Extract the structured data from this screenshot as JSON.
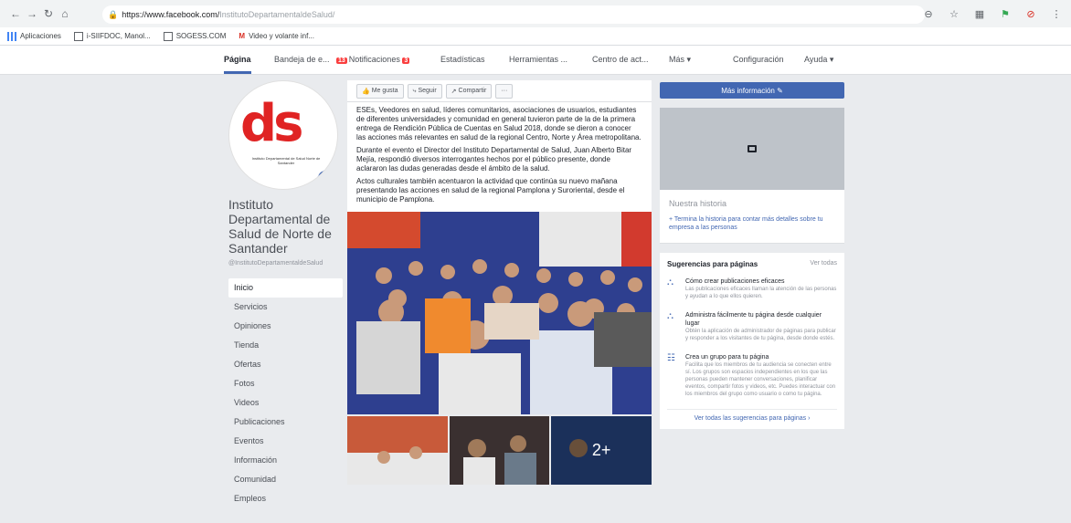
{
  "browser": {
    "url_host": "https://www.facebook.com/",
    "url_path": "InstitutoDepartamentaldeSalud/",
    "bookmarks": [
      {
        "label": "Aplicaciones"
      },
      {
        "label": "i-SIIFDOC, Manol..."
      },
      {
        "label": "SOGESS.COM"
      },
      {
        "label": "Video y volante inf..."
      }
    ]
  },
  "fb_nav": {
    "pagina": "Página",
    "bandeja": "Bandeja de e...",
    "notif_badge": "13",
    "notificaciones": "Notificaciones",
    "notif_count": "3",
    "estadisticas": "Estadísticas",
    "herramientas": "Herramientas ...",
    "centro": "Centro de act...",
    "mas": "Más ▾",
    "configuracion": "Configuración",
    "ayuda": "Ayuda ▾"
  },
  "page": {
    "logo_letters": "ds",
    "logo_sub": "Instituto Departamental de Salud Norte de Santander",
    "name": "Instituto Departamental de Salud de Norte de Santander",
    "handle": "@InstitutoDepartamentaldeSalud"
  },
  "side_nav": [
    {
      "label": "Inicio",
      "selected": true
    },
    {
      "label": "Servicios"
    },
    {
      "label": "Opiniones"
    },
    {
      "label": "Tienda"
    },
    {
      "label": "Ofertas"
    },
    {
      "label": "Fotos"
    },
    {
      "label": "Videos"
    },
    {
      "label": "Publicaciones"
    },
    {
      "label": "Eventos"
    },
    {
      "label": "Información"
    },
    {
      "label": "Comunidad"
    },
    {
      "label": "Empleos"
    }
  ],
  "actions": {
    "like": "Me gusta",
    "follow": "Seguir",
    "share": "Compartir",
    "more": "···"
  },
  "post": {
    "p1": "ESEs, Veedores en salud, líderes comunitarios, asociaciones de usuarios, estudiantes de diferentes universidades y comunidad en general tuvieron parte de la de la primera entrega de Rendición Pública de Cuentas en Salud 2018, donde se dieron a conocer las acciones más relevantes en salud de la regional Centro, Norte y Área metropolitana.",
    "p2": "Durante el evento el Director del Instituto Departamental de Salud, Juan Alberto Bitar Mejía, respondió diversos interrogantes hechos por el público presente, donde aclararon las dudas generadas desde el ámbito de la salud.",
    "p3": "Actos culturales también acentuaron la actividad que continúa su nuevo mañana presentando las acciones en salud de la regional Pamplona y Suroriental, desde el municipio de Pamplona."
  },
  "photos": {
    "more_label": "2+"
  },
  "right": {
    "cta": "Más información ✎",
    "story_title": "Nuestra historia",
    "story_link": "+ Termina la historia para contar más detalles sobre tu empresa a las personas",
    "sugg_title": "Sugerencias para páginas",
    "see_all": "Ver todas",
    "suggestions": [
      {
        "title": "Cómo crear publicaciones eficaces",
        "desc": "Las publicaciones eficaces llaman la atención de las personas y ayudan a lo que ellos quieren."
      },
      {
        "title": "Administra fácilmente tu página desde cualquier lugar",
        "desc": "Obtén la aplicación de administrador de páginas para publicar y responder a los visitantes de tu página, desde donde estés."
      },
      {
        "title": "Crea un grupo para tu página",
        "desc": "Facilita que los miembros de tu audiencia se conecten entre sí. Los grupos son espacios independientes en los que las personas pueden mantener conversaciones, planificar eventos, compartir fotos y videos, etc. Puedes interactuar con los miembros del grupo como usuario o como tu página."
      }
    ],
    "footer": "Ver todas las sugerencias para páginas ›"
  },
  "colors": {
    "fb_blue": "#4267b2",
    "badge_red": "#fa3e3e",
    "logo_red": "#e02323"
  }
}
